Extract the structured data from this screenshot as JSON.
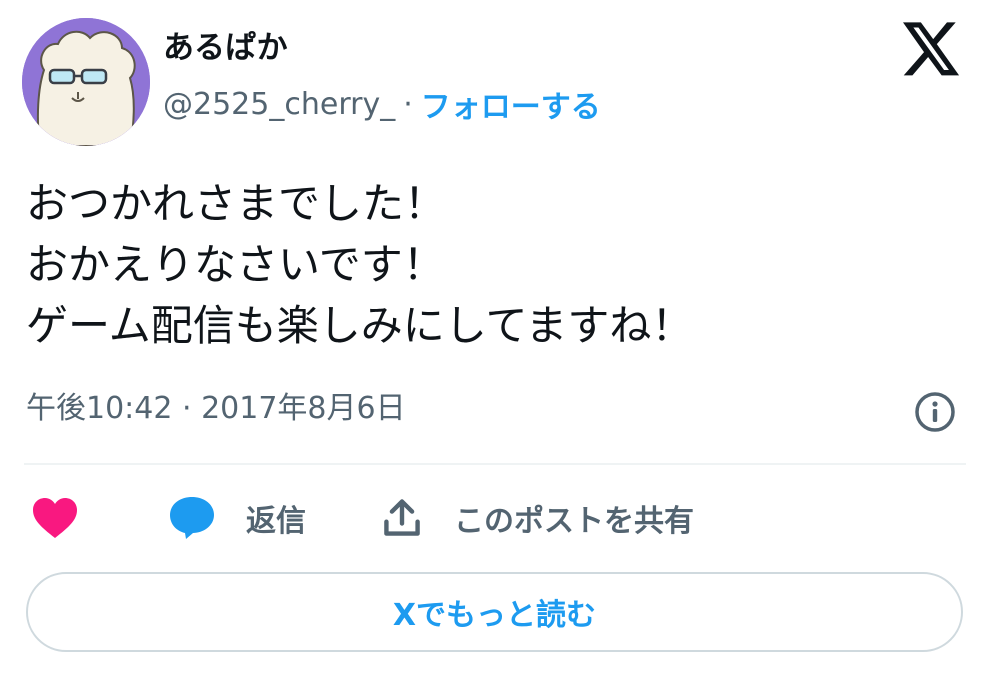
{
  "user": {
    "display_name": "あるぱか",
    "handle": "@2525_cherry_",
    "separator": "·",
    "follow_label": "フォローする"
  },
  "tweet": {
    "text": "おつかれさまでした！\nおかえりなさいです！\nゲーム配信も楽しみにしてますね！",
    "timestamp": "午後10:42 · 2017年8月6日"
  },
  "actions": {
    "reply_label": "返信",
    "share_label": "このポストを共有"
  },
  "read_more_label": "Xでもっと読む",
  "colors": {
    "accent": "#1d9bf0",
    "like": "#f91880",
    "secondary_text": "#536471",
    "avatar_bg": "#8f74d6"
  },
  "icons": [
    "x-logo-icon",
    "info-icon",
    "heart-icon",
    "reply-bubble-icon",
    "share-upload-icon"
  ]
}
